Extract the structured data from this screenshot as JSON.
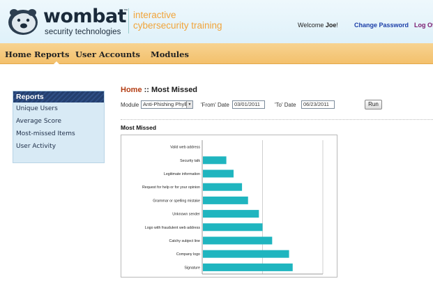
{
  "brand": {
    "name": "wombat",
    "trademark": "™",
    "subtitle": "security technologies",
    "tagline_line1": "interactive",
    "tagline_line2": "cybersecurity training"
  },
  "user_bar": {
    "welcome_prefix": "Welcome ",
    "user_name": "Joe",
    "welcome_suffix": "!",
    "change_password": "Change Password",
    "log_off": "Log Of"
  },
  "nav": {
    "items": [
      "Home",
      "Reports",
      "User Accounts",
      "Modules"
    ],
    "active": "Reports"
  },
  "sidebar": {
    "title": "Reports",
    "items": [
      "Unique Users",
      "Average Score",
      "Most-missed Items",
      "User Activity"
    ]
  },
  "breadcrumb": {
    "home": "Home",
    "separator": " :: ",
    "current": "Most Missed"
  },
  "filters": {
    "module_label": "Module",
    "module_value": "Anti-Phishing Phyllis",
    "from_label": "'From' Date",
    "from_value": "03/01/2011",
    "to_label": "'To' Date",
    "to_value": "06/23/2011",
    "run_label": "Run"
  },
  "section_title": "Most Missed",
  "colors": {
    "bar": "#1fb5bf",
    "nav_bg": "#f3c06c",
    "tagline": "#f1a43a",
    "crumb_link": "#b33d13"
  },
  "chart_data": {
    "type": "bar",
    "orientation": "horizontal",
    "categories": [
      "Valid web address",
      "Security talk",
      "Legitimate information",
      "Request for help or for your opinion",
      "Grammar or spelling mistake",
      "Unknown sender",
      "Logo with fraudulent web address",
      "Catchy subject line",
      "Company logo",
      "Signature"
    ],
    "values": [
      0,
      20,
      26,
      33,
      38,
      47,
      50,
      58,
      72,
      75
    ],
    "xlim": [
      0,
      100
    ],
    "xticks": [
      "0",
      "50",
      "100"
    ],
    "grid": true
  }
}
